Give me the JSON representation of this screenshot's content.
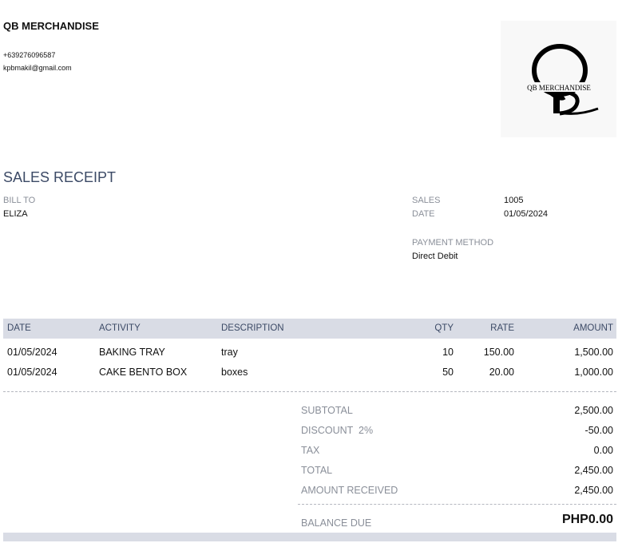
{
  "company": {
    "name": "QB MERCHANDISE",
    "phone": "+639276096587",
    "email": "kpbmakil@gmail.com",
    "logo_text": "QB MERCHANDISE"
  },
  "doc_title": "SALES RECEIPT",
  "bill_to": {
    "label": "BILL TO",
    "value": "ELIZA"
  },
  "meta": {
    "sales_label": "SALES",
    "sales_value": "1005",
    "date_label": "DATE",
    "date_value": "01/05/2024",
    "payment_label": "PAYMENT METHOD",
    "payment_value": "Direct Debit"
  },
  "table": {
    "headers": [
      "DATE",
      "ACTIVITY",
      "DESCRIPTION",
      "QTY",
      "RATE",
      "AMOUNT"
    ],
    "rows": [
      [
        "01/05/2024",
        "BAKING TRAY",
        "tray",
        "10",
        "150.00",
        "1,500.00"
      ],
      [
        "01/05/2024",
        "CAKE BENTO BOX",
        "boxes",
        "50",
        "20.00",
        "1,000.00"
      ]
    ]
  },
  "totals": {
    "subtotal_label": "SUBTOTAL",
    "subtotal_value": "2,500.00",
    "discount_label": "DISCOUNT  2%",
    "discount_value": "-50.00",
    "tax_label": "TAX",
    "tax_value": "0.00",
    "total_label": "TOTAL",
    "total_value": "2,450.00",
    "received_label": "AMOUNT RECEIVED",
    "received_value": "2,450.00",
    "balance_label": "BALANCE DUE",
    "balance_value": "PHP0.00"
  }
}
